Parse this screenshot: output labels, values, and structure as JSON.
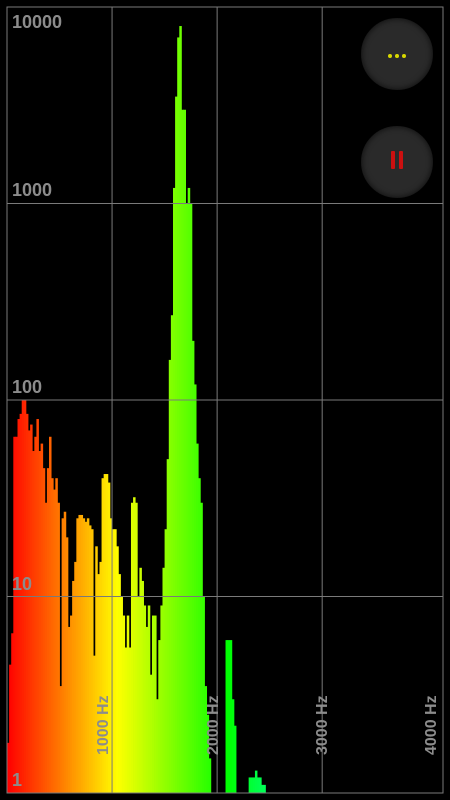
{
  "colors": {
    "background": "#000000",
    "grid": "#7a7a7a",
    "axis_text": "#8c8c8c",
    "more_dots": "#d8d800",
    "pause_bars": "#cc1010",
    "button_bg": "#2a2a2a"
  },
  "controls": {
    "more_icon": "more-horizontal-icon",
    "pause_icon": "pause-icon"
  },
  "chart_data": {
    "type": "bar",
    "y_scale": "log",
    "ylim": [
      1,
      10000
    ],
    "xlim": [
      0,
      4150
    ],
    "y_tick_labels": [
      "10000",
      "1000",
      "100",
      "10",
      "1"
    ],
    "x_tick_labels": [
      "1000 Hz",
      "2000 Hz",
      "3000 Hz",
      "4000 Hz"
    ],
    "bin_width_hz": 20,
    "bin_start_hz": [
      0,
      20,
      40,
      60,
      80,
      100,
      120,
      140,
      160,
      180,
      200,
      220,
      240,
      260,
      280,
      300,
      320,
      340,
      360,
      380,
      400,
      420,
      440,
      460,
      480,
      500,
      520,
      540,
      560,
      580,
      600,
      620,
      640,
      660,
      680,
      700,
      720,
      740,
      760,
      780,
      800,
      820,
      840,
      860,
      880,
      900,
      920,
      940,
      960,
      980,
      1000,
      1020,
      1040,
      1060,
      1080,
      1100,
      1120,
      1140,
      1160,
      1180,
      1200,
      1220,
      1240,
      1260,
      1280,
      1300,
      1320,
      1340,
      1360,
      1380,
      1400,
      1420,
      1440,
      1460,
      1480,
      1500,
      1520,
      1540,
      1560,
      1580,
      1600,
      1620,
      1640,
      1660,
      1680,
      1700,
      1720,
      1740,
      1760,
      1780,
      1800,
      1820,
      1840,
      1860,
      1880,
      1900,
      1920,
      1940,
      1960,
      1980,
      2000,
      2020,
      2040,
      2060,
      2080,
      2100,
      2120,
      2140,
      2160,
      2180,
      2200,
      2220,
      2240,
      2260,
      2280,
      2300,
      2320,
      2340,
      2360,
      2380,
      2400,
      2420,
      2440,
      2460,
      2480,
      2500,
      2520,
      2540,
      2560,
      2580,
      2600,
      2620,
      2640,
      2660,
      2680,
      2700,
      2720,
      2740,
      2760,
      2780,
      2800,
      2820,
      2840,
      2860,
      2880,
      2900,
      2920,
      2940,
      2960,
      2980,
      3000,
      3020,
      3040,
      3060,
      3080,
      3100,
      3120,
      3140,
      3160,
      3180,
      3200,
      3220,
      3240,
      3260,
      3280,
      3300,
      3320,
      3340,
      3360,
      3380,
      3400,
      3420,
      3440,
      3460,
      3480,
      3500,
      3520,
      3540,
      3560,
      3580,
      3600,
      3620,
      3640,
      3660,
      3680,
      3700,
      3720,
      3740,
      3760,
      3780,
      3800,
      3820,
      3840,
      3860,
      3880,
      3900,
      3920,
      3940,
      3960,
      3980,
      4000,
      4020,
      4040,
      4060,
      4080,
      4100
    ],
    "values": [
      1.8,
      4.5,
      6.5,
      65,
      65,
      80,
      85,
      100,
      100,
      85,
      70,
      75,
      55,
      65,
      80,
      55,
      60,
      45,
      30,
      45,
      65,
      40,
      35,
      40,
      30,
      3.5,
      25,
      27,
      20,
      7,
      8,
      12,
      15,
      25,
      26,
      26,
      25,
      24,
      25,
      23,
      22,
      5,
      18,
      13,
      15,
      40,
      42,
      42,
      38,
      25,
      22,
      22,
      18,
      13,
      10,
      8,
      5.5,
      8,
      5.5,
      30,
      32,
      30,
      10,
      14,
      12,
      9,
      7,
      9,
      4,
      8,
      8,
      3,
      6,
      9,
      14,
      22,
      50,
      160,
      270,
      1200,
      3500,
      7000,
      8000,
      3000,
      3000,
      1000,
      1200,
      1000,
      200,
      120,
      60,
      40,
      30,
      10,
      3.5,
      2.5,
      1.5,
      1,
      1,
      1,
      1,
      1,
      1,
      1,
      6,
      6,
      6,
      3,
      2.2,
      1,
      1,
      1,
      1,
      1,
      1,
      1.2,
      1.2,
      1.2,
      1.3,
      1.2,
      1.2,
      1.1,
      1.1,
      1,
      1,
      1,
      1,
      1,
      1,
      1,
      1,
      1,
      1,
      1,
      1,
      1,
      1,
      1,
      1,
      1,
      1,
      1,
      1,
      1,
      1,
      1,
      1,
      1,
      1,
      1,
      1,
      1,
      1,
      1,
      1,
      1,
      1,
      1,
      1,
      1,
      1,
      1,
      1,
      1,
      1,
      1,
      1,
      1,
      1,
      1,
      1,
      1,
      1,
      1,
      1,
      1,
      1,
      1,
      1,
      1,
      1,
      1,
      1,
      1,
      1,
      1,
      1,
      1,
      1,
      1,
      1,
      1,
      1,
      1,
      1,
      1,
      1,
      1,
      1,
      1,
      1,
      1,
      1,
      1,
      1,
      1,
      1,
      1,
      1,
      1,
      1
    ]
  }
}
